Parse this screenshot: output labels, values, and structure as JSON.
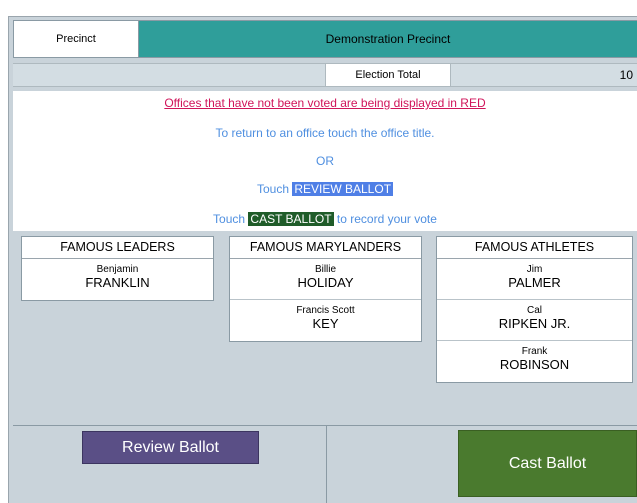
{
  "header": {
    "precinct_label": "Precinct",
    "precinct_name": "Demonstration Precinct"
  },
  "totals": {
    "label": "Election Total",
    "value": "10"
  },
  "message": {
    "line1": "Offices that have not been voted are being displayed in RED",
    "line2": "To return to an office touch the office title.",
    "line3": "OR",
    "line4_prefix": "Touch ",
    "line4_highlight": "REVIEW BALLOT",
    "line5_prefix": "Touch ",
    "line5_highlight": "CAST BALLOT",
    "line5_suffix": " to record your vote"
  },
  "contests": [
    {
      "title": "FAMOUS LEADERS",
      "candidates": [
        {
          "first": "Benjamin",
          "last": "FRANKLIN"
        }
      ]
    },
    {
      "title": "FAMOUS MARYLANDERS",
      "candidates": [
        {
          "first": "Billie",
          "last": "HOLIDAY"
        },
        {
          "first": "Francis Scott",
          "last": "KEY"
        }
      ]
    },
    {
      "title": "FAMOUS ATHLETES",
      "candidates": [
        {
          "first": "Jim",
          "last": "PALMER"
        },
        {
          "first": "Cal",
          "last": "RIPKEN JR."
        },
        {
          "first": "Frank",
          "last": "ROBINSON"
        }
      ]
    }
  ],
  "buttons": {
    "review": "Review Ballot",
    "cast": "Cast Ballot"
  },
  "colors": {
    "header_teal": "#2f9e9a",
    "unvoted_red": "#d0145a",
    "info_blue": "#4f8fe0",
    "review_purple": "#5a4f86",
    "cast_green": "#4a7a2e"
  }
}
